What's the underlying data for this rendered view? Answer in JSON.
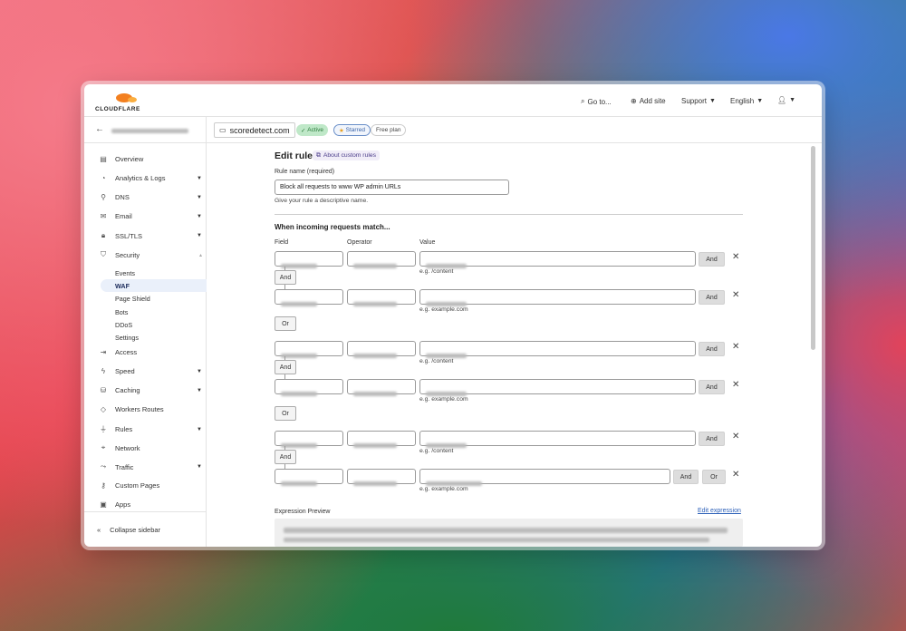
{
  "brand": "CLOUDFLARE",
  "topnav": {
    "goto": "Go to...",
    "add_site": "Add site",
    "support": "Support",
    "language": "English"
  },
  "site": {
    "domain": "scoredetect.com",
    "status": "Active",
    "starred": "Starred",
    "plan": "Free plan"
  },
  "sidebar": {
    "items": [
      {
        "label": "Overview",
        "icon": "document-icon",
        "caret": false
      },
      {
        "label": "Analytics & Logs",
        "icon": "chart-icon",
        "caret": true
      },
      {
        "label": "DNS",
        "icon": "network-tree-icon",
        "caret": true
      },
      {
        "label": "Email",
        "icon": "mail-icon",
        "caret": true
      },
      {
        "label": "SSL/TLS",
        "icon": "lock-icon",
        "caret": true
      },
      {
        "label": "Security",
        "icon": "shield-icon",
        "caret": true
      },
      {
        "label": "Access",
        "icon": "access-icon",
        "caret": false
      },
      {
        "label": "Speed",
        "icon": "bolt-icon",
        "caret": true
      },
      {
        "label": "Caching",
        "icon": "drive-icon",
        "caret": true
      },
      {
        "label": "Workers Routes",
        "icon": "workers-icon",
        "caret": false
      },
      {
        "label": "Rules",
        "icon": "filter-icon",
        "caret": true
      },
      {
        "label": "Network",
        "icon": "location-pin-icon",
        "caret": false
      },
      {
        "label": "Traffic",
        "icon": "traffic-icon",
        "caret": true
      },
      {
        "label": "Custom Pages",
        "icon": "wrench-icon",
        "caret": false
      },
      {
        "label": "Apps",
        "icon": "apps-icon",
        "caret": false
      }
    ],
    "security_sub": [
      "Events",
      "WAF",
      "Page Shield",
      "Bots",
      "DDoS",
      "Settings"
    ],
    "collapse": "Collapse sidebar"
  },
  "form": {
    "title": "Edit rule",
    "about": "About custom rules",
    "rule_name_label": "Rule name (required)",
    "rule_name_value": "Block all requests to www WP admin URLs",
    "rule_name_help": "Give your rule a descriptive name.",
    "match_heading": "When incoming requests match...",
    "col_field": "Field",
    "col_operator": "Operator",
    "col_value": "Value",
    "and": "And",
    "or": "Or",
    "hint_content": "e.g. /content",
    "hint_example": "e.g. example.com",
    "expr_label": "Expression Preview",
    "edit_expr": "Edit expression"
  }
}
